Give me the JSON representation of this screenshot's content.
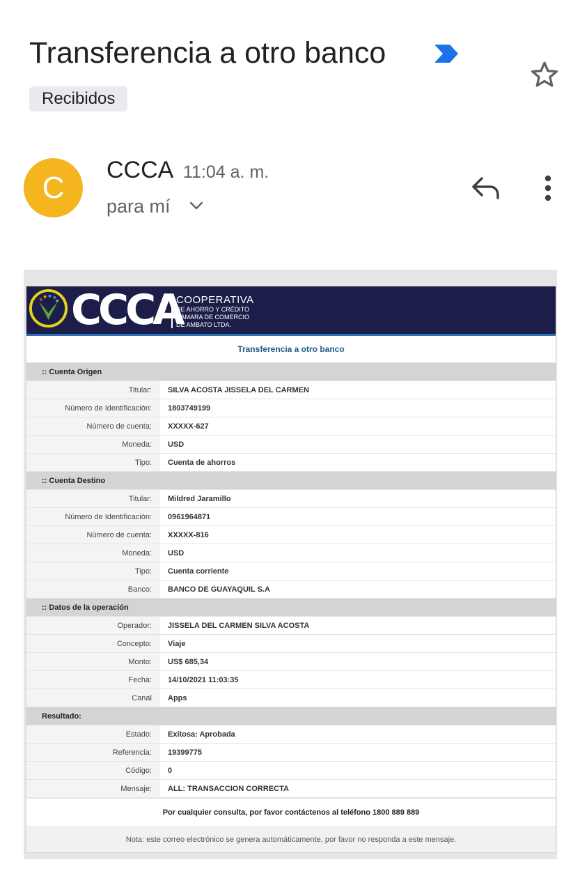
{
  "header": {
    "subject": "Transferencia a otro banco",
    "label_chip": "Recibidos",
    "importance_icon": "importance-marker-icon",
    "star_icon": "star-outline-icon"
  },
  "message": {
    "avatar_letter": "C",
    "avatar_color": "#f4b51f",
    "sender": "CCCA",
    "time": "11:04 a. m.",
    "recipient": "para mí",
    "reply_icon": "reply-icon",
    "more_icon": "more-vert-icon"
  },
  "email": {
    "brand": "CCCA",
    "brand_line1": "COOPERATIVA",
    "brand_line2": "DE AHORRO Y CRÉDITO",
    "brand_line3": "CÁMARA DE COMERCIO",
    "brand_line4": "DE AMBATO LTDA.",
    "title": "Transferencia a otro banco",
    "sections": {
      "origen": {
        "heading": ":: Cuenta Origen",
        "rows": [
          {
            "label": "Titular:",
            "value": "SILVA ACOSTA JISSELA DEL CARMEN"
          },
          {
            "label": "Número de Identificación:",
            "value": "1803749199"
          },
          {
            "label": "Número de cuenta:",
            "value": "XXXXX-627"
          },
          {
            "label": "Moneda:",
            "value": "USD"
          },
          {
            "label": "Tipo:",
            "value": "Cuenta de ahorros"
          }
        ]
      },
      "destino": {
        "heading": ":: Cuenta Destino",
        "rows": [
          {
            "label": "Titular:",
            "value": "Mildred Jaramillo"
          },
          {
            "label": "Número de Identificación:",
            "value": "0961964871"
          },
          {
            "label": "Número de cuenta:",
            "value": "XXXXX-816"
          },
          {
            "label": "Moneda:",
            "value": "USD"
          },
          {
            "label": "Tipo:",
            "value": "Cuenta corriente"
          },
          {
            "label": "Banco:",
            "value": "BANCO DE GUAYAQUIL S.A"
          }
        ]
      },
      "operacion": {
        "heading": ":: Datos de la operación",
        "rows": [
          {
            "label": "Operador:",
            "value": "JISSELA DEL CARMEN SILVA ACOSTA"
          },
          {
            "label": "Concepto:",
            "value": "Viaje"
          },
          {
            "label": "Monto:",
            "value": "US$ 685,34"
          },
          {
            "label": "Fecha:",
            "value": "14/10/2021 11:03:35"
          },
          {
            "label": "Canal",
            "value": "Apps"
          }
        ]
      },
      "resultado": {
        "heading": "Resultado:",
        "rows": [
          {
            "label": "Estado:",
            "value": "Exitosa: Aprobada"
          },
          {
            "label": "Referencia:",
            "value": "19399775"
          },
          {
            "label": "Código:",
            "value": "0"
          },
          {
            "label": "Mensaje:",
            "value": "ALL: TRANSACCION CORRECTA"
          }
        ]
      }
    },
    "contact": "Por cualquier consulta, por favor contáctenos al teléfono 1800 889 889",
    "note": "Nota: este correo electrónico se genera automáticamente, por favor no responda a este mensaje."
  }
}
